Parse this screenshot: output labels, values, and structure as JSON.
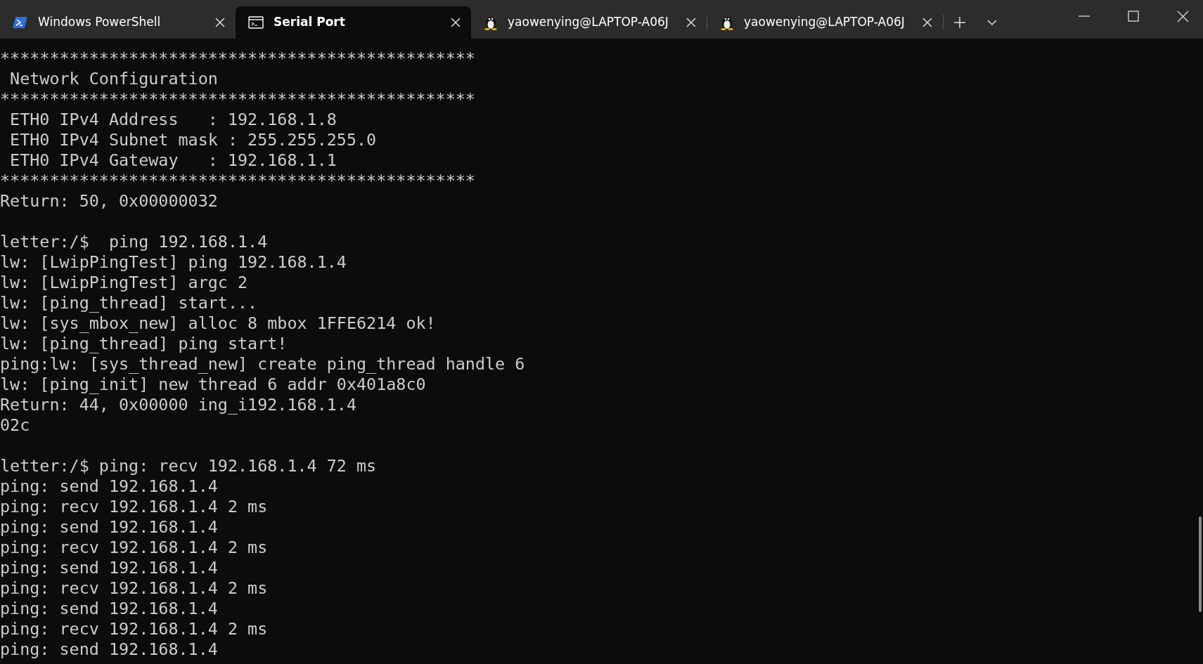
{
  "tabs": [
    {
      "title": "Windows PowerShell",
      "kind": "powershell",
      "selected": false
    },
    {
      "title": "Serial Port",
      "kind": "console",
      "selected": true
    },
    {
      "title": "yaowenying@LAPTOP-A06J",
      "kind": "linux",
      "selected": false
    },
    {
      "title": "yaowenying@LAPTOP-A06J",
      "kind": "linux",
      "selected": false
    }
  ],
  "terminal": {
    "blocks": [
      {
        "lines": [
          "************************************************",
          " Network Configuration",
          "************************************************",
          " ETH0 IPv4 Address   : 192.168.1.8",
          " ETH0 IPv4 Subnet mask : 255.255.255.0",
          " ETH0 IPv4 Gateway   : 192.168.1.1",
          "************************************************",
          "Return: 50, 0x00000032"
        ]
      },
      {
        "lines": [
          "letter:/$  ping 192.168.1.4",
          "lw: [LwipPingTest] ping 192.168.1.4",
          "lw: [LwipPingTest] argc 2",
          "lw: [ping_thread] start...",
          "lw: [sys_mbox_new] alloc 8 mbox 1FFE6214 ok!",
          "lw: [ping_thread] ping start!",
          "ping:lw: [sys_thread_new] create ping_thread handle 6",
          "lw: [ping_init] new thread 6 addr 0x401a8c0",
          "Return: 44, 0x00000 ing_i192.168.1.4",
          "02c"
        ]
      },
      {
        "lines": [
          "letter:/$ ping: recv 192.168.1.4 72 ms",
          "ping: send 192.168.1.4",
          "ping: recv 192.168.1.4 2 ms",
          "ping: send 192.168.1.4",
          "ping: recv 192.168.1.4 2 ms",
          "ping: send 192.168.1.4",
          "ping: recv 192.168.1.4 2 ms",
          "ping: send 192.168.1.4",
          "ping: recv 192.168.1.4 2 ms",
          "ping: send 192.168.1.4"
        ]
      }
    ]
  }
}
